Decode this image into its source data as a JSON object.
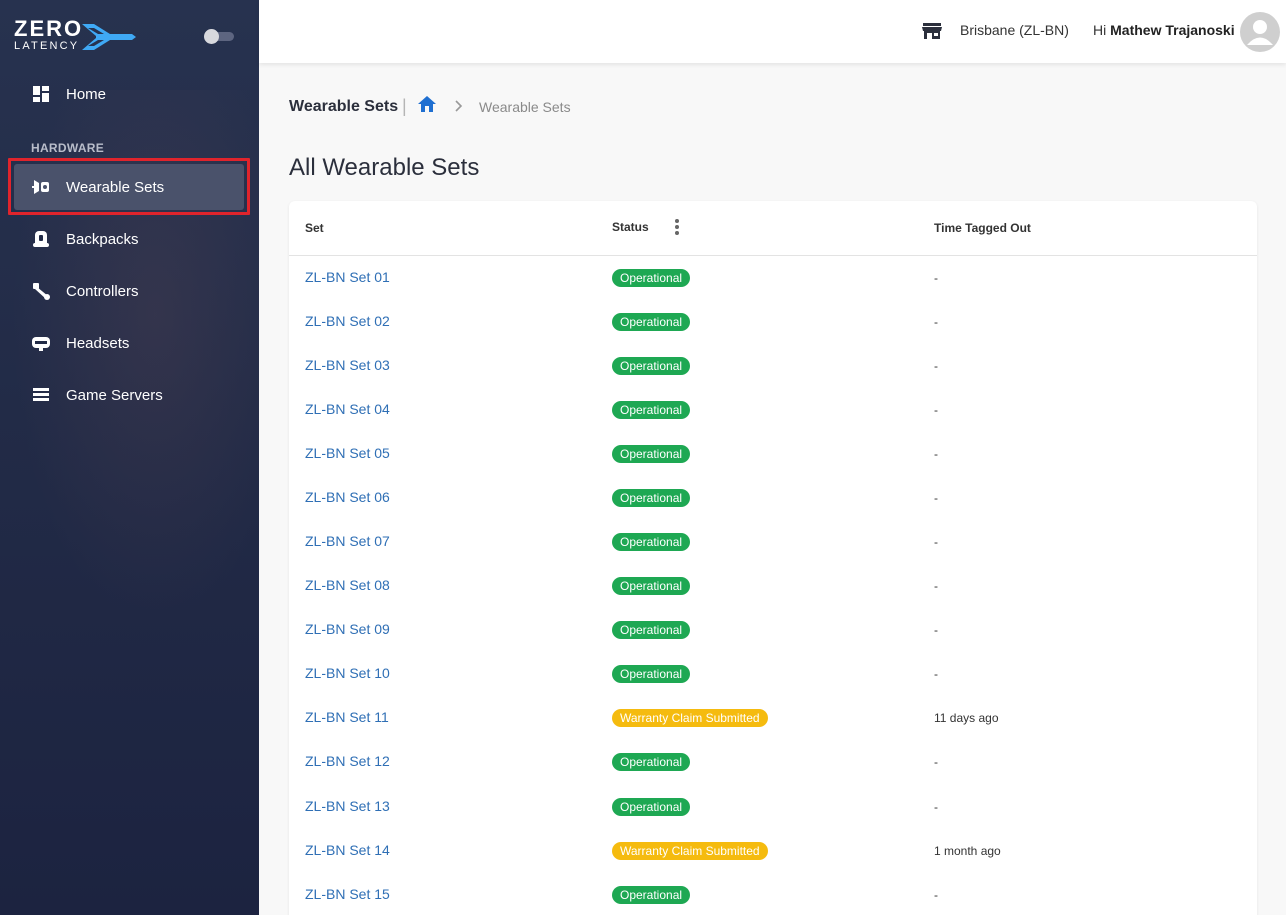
{
  "brand": {
    "line1": "ZERO",
    "line2": "LATENCY"
  },
  "colors": {
    "accent": "#2f6fb5",
    "operational": "#1ea853",
    "warranty": "#f5bb0f",
    "sidebar": "#222b47",
    "highlight": "#e0242c"
  },
  "sidebar": {
    "home": {
      "label": "Home",
      "icon": "dashboard-icon"
    },
    "section_label": "HARDWARE",
    "items": [
      {
        "label": "Wearable Sets",
        "icon": "wearable-set-icon",
        "active": true
      },
      {
        "label": "Backpacks",
        "icon": "backpack-icon"
      },
      {
        "label": "Controllers",
        "icon": "controller-icon"
      },
      {
        "label": "Headsets",
        "icon": "headset-icon"
      },
      {
        "label": "Game Servers",
        "icon": "server-icon"
      }
    ]
  },
  "header": {
    "location": "Brisbane (ZL-BN)",
    "greeting": "Hi",
    "user_name": "Mathew Trajanoski"
  },
  "breadcrumb": {
    "title": "Wearable Sets",
    "separator": "|",
    "current": "Wearable Sets"
  },
  "page_title": "All Wearable Sets",
  "table": {
    "columns": [
      "Set",
      "Status",
      "Time Tagged Out"
    ],
    "rows": [
      {
        "set": "ZL-BN Set 01",
        "status": "Operational",
        "time": "-"
      },
      {
        "set": "ZL-BN Set 02",
        "status": "Operational",
        "time": "-"
      },
      {
        "set": "ZL-BN Set 03",
        "status": "Operational",
        "time": "-"
      },
      {
        "set": "ZL-BN Set 04",
        "status": "Operational",
        "time": "-"
      },
      {
        "set": "ZL-BN Set 05",
        "status": "Operational",
        "time": "-"
      },
      {
        "set": "ZL-BN Set 06",
        "status": "Operational",
        "time": "-"
      },
      {
        "set": "ZL-BN Set 07",
        "status": "Operational",
        "time": "-"
      },
      {
        "set": "ZL-BN Set 08",
        "status": "Operational",
        "time": "-"
      },
      {
        "set": "ZL-BN Set 09",
        "status": "Operational",
        "time": "-"
      },
      {
        "set": "ZL-BN Set 10",
        "status": "Operational",
        "time": "-"
      },
      {
        "set": "ZL-BN Set 11",
        "status": "Warranty Claim Submitted",
        "time": "11 days ago"
      },
      {
        "set": "ZL-BN Set 12",
        "status": "Operational",
        "time": "-"
      },
      {
        "set": "ZL-BN Set 13",
        "status": "Operational",
        "time": "-"
      },
      {
        "set": "ZL-BN Set 14",
        "status": "Warranty Claim Submitted",
        "time": "1 month ago"
      },
      {
        "set": "ZL-BN Set 15",
        "status": "Operational",
        "time": "-"
      }
    ]
  }
}
